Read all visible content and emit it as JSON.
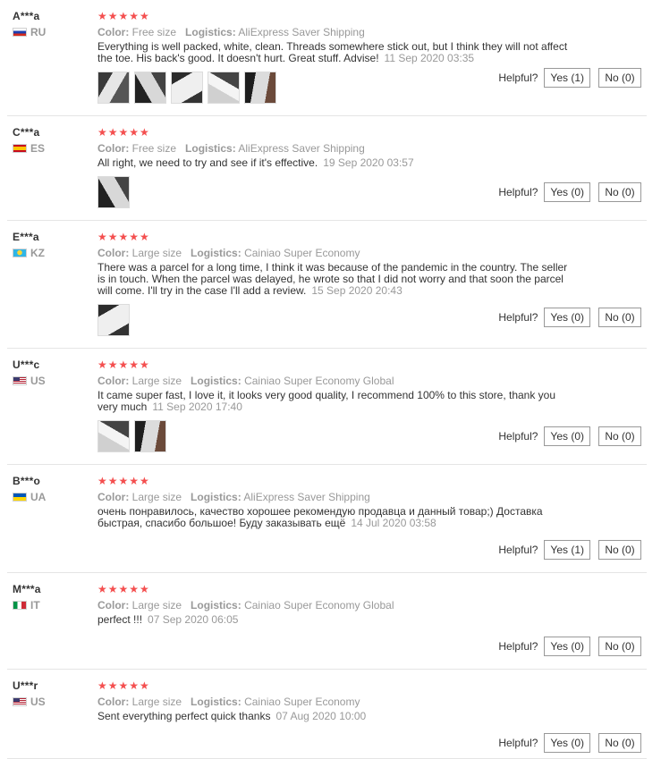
{
  "stars_text": "★★★★★",
  "helpful_label": "Helpful?",
  "colors": {
    "star": "#f44f4f",
    "meta": "#999999",
    "border": "#e5e5e5"
  },
  "reviews": [
    {
      "name": "A***a",
      "country": "RU",
      "flag": "russia",
      "color_label": "Color:",
      "color": "Free size",
      "logistics_label": "Logistics:",
      "logistics": "AliExpress Saver Shipping",
      "text": "Everything is well packed, white, clean. Threads somewhere stick out, but I think they will not affect the toe. His back's good. It doesn't hurt. Great stuff. Advise!",
      "date": "11 Sep 2020 03:35",
      "photos": 5,
      "yes": "Yes (1)",
      "no": "No (0)"
    },
    {
      "name": "C***a",
      "country": "ES",
      "flag": "spain",
      "color_label": "Color:",
      "color": "Free size",
      "logistics_label": "Logistics:",
      "logistics": "AliExpress Saver Shipping",
      "text": "All right, we need to try and see if it's effective.",
      "date": "19 Sep 2020 03:57",
      "photos": 1,
      "yes": "Yes (0)",
      "no": "No (0)"
    },
    {
      "name": "E***a",
      "country": "KZ",
      "flag": "kazakhstan",
      "color_label": "Color:",
      "color": "Large size",
      "logistics_label": "Logistics:",
      "logistics": "Cainiao Super Economy",
      "text": "There was a parcel for a long time, I think it was because of the pandemic in the country. The seller is in touch. When the parcel was delayed, he wrote so that I did not worry and that soon the parcel will come. I'll try in the case I'll add a review.",
      "date": "15 Sep 2020 20:43",
      "photos": 1,
      "yes": "Yes (0)",
      "no": "No (0)"
    },
    {
      "name": "U***c",
      "country": "US",
      "flag": "usa",
      "color_label": "Color:",
      "color": "Large size",
      "logistics_label": "Logistics:",
      "logistics": "Cainiao Super Economy Global",
      "text": "It came super fast, I love it, it looks very good quality, I recommend 100% to this store, thank you very much",
      "date": "11 Sep 2020 17:40",
      "photos": 2,
      "yes": "Yes (0)",
      "no": "No (0)"
    },
    {
      "name": "B***o",
      "country": "UA",
      "flag": "ukraine",
      "color_label": "Color:",
      "color": "Large size",
      "logistics_label": "Logistics:",
      "logistics": "AliExpress Saver Shipping",
      "text": "очень понравилось, качество хорошее рекомендую продавца и данный товар;) Доставка быстрая, спасибо большое! Буду заказывать ещё",
      "date": "14 Jul 2020 03:58",
      "photos": 0,
      "yes": "Yes (1)",
      "no": "No (0)"
    },
    {
      "name": "M***a",
      "country": "IT",
      "flag": "italy",
      "color_label": "Color:",
      "color": "Large size",
      "logistics_label": "Logistics:",
      "logistics": "Cainiao Super Economy Global",
      "text": "perfect !!!",
      "date": "07 Sep 2020 06:05",
      "photos": 0,
      "yes": "Yes (0)",
      "no": "No (0)"
    },
    {
      "name": "U***r",
      "country": "US",
      "flag": "usa",
      "color_label": "Color:",
      "color": "Large size",
      "logistics_label": "Logistics:",
      "logistics": "Cainiao Super Economy",
      "text": "Sent everything perfect quick thanks",
      "date": "07 Aug 2020 10:00",
      "photos": 0,
      "yes": "Yes (0)",
      "no": "No (0)"
    }
  ]
}
